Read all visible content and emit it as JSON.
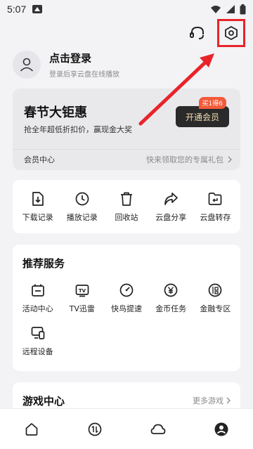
{
  "status_bar": {
    "time": "5:07",
    "icons": [
      "app-notification-icon",
      "wifi-icon",
      "signal-icon",
      "battery-icon"
    ]
  },
  "header": {
    "icons": [
      "headset-icon",
      "settings-icon"
    ]
  },
  "profile": {
    "title": "点击登录",
    "subtitle": "登录后享云盘在线播放"
  },
  "vip": {
    "title": "春节大钜惠",
    "description": "抢全年超低折扣价，赢现金大奖",
    "badge": "买1得6",
    "button": "开通会员",
    "footer_left": "会员中心",
    "footer_right": "快来领取您的专属礼包"
  },
  "tools": [
    {
      "label": "下载记录",
      "icon": "download-record-icon"
    },
    {
      "label": "播放记录",
      "icon": "clock-icon"
    },
    {
      "label": "回收站",
      "icon": "trash-icon"
    },
    {
      "label": "云盘分享",
      "icon": "share-icon"
    },
    {
      "label": "云盘转存",
      "icon": "folder-save-icon"
    }
  ],
  "services": {
    "title": "推荐服务",
    "items": [
      {
        "label": "活动中心",
        "icon": "calendar-icon"
      },
      {
        "label": "TV迅雷",
        "icon": "tv-icon"
      },
      {
        "label": "快鸟提速",
        "icon": "speedometer-icon"
      },
      {
        "label": "金币任务",
        "icon": "coin-icon"
      },
      {
        "label": "金融专区",
        "icon": "finance-icon"
      },
      {
        "label": "远程设备",
        "icon": "device-icon"
      }
    ]
  },
  "game": {
    "title": "游戏中心",
    "more": "更多游戏"
  },
  "tabs": [
    {
      "icon": "home-icon",
      "active": false
    },
    {
      "icon": "transfer-icon",
      "active": false
    },
    {
      "icon": "cloud-icon",
      "active": false
    },
    {
      "icon": "profile-icon",
      "active": true
    }
  ],
  "colors": {
    "annotation": "#e8242a",
    "vip_button_bg": "#2a2a2a",
    "vip_button_text": "#f2dcb0",
    "badge": "#f25a3a"
  }
}
